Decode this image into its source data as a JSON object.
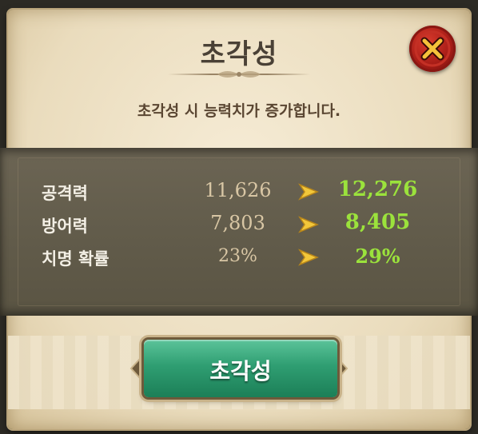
{
  "dialog": {
    "title": "초각성",
    "subtitle": "초각성 시 능력치가 증가합니다.",
    "close_icon": "close-x-icon"
  },
  "stats": [
    {
      "label": "공격력",
      "before": "11,626",
      "after": "12,276"
    },
    {
      "label": "방어력",
      "before": "7,803",
      "after": "8,405"
    },
    {
      "label": "치명 확률",
      "before": "23%",
      "after": "29%"
    }
  ],
  "action_button": {
    "label": "초각성"
  },
  "colors": {
    "increase": "#9be23c",
    "button_green": "#2f9e72",
    "close_red": "#a81d17",
    "arrow_gold": "#f2c73a"
  }
}
